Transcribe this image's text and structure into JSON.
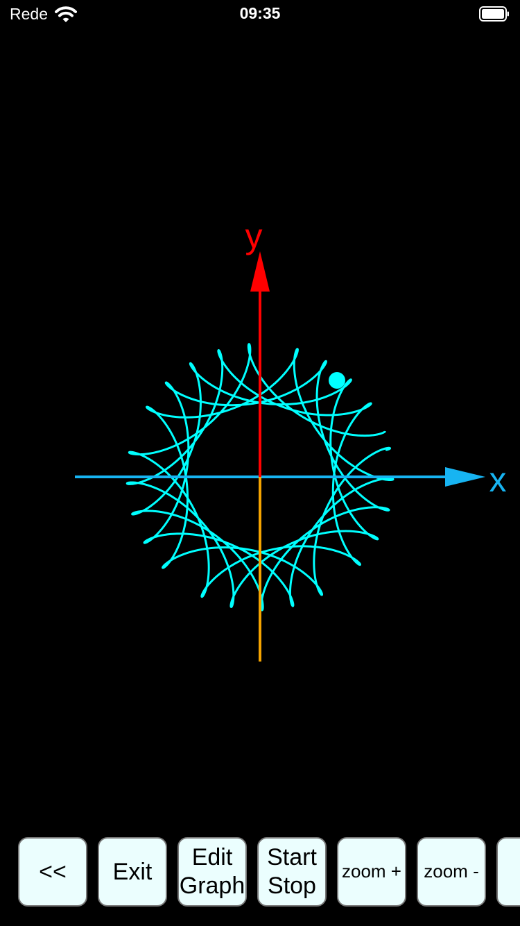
{
  "status_bar": {
    "carrier": "Rede",
    "time": "09:35"
  },
  "graph": {
    "x_axis_label": "x",
    "y_axis_label": "y",
    "colors": {
      "curve": "#00ffff",
      "x_axis": "#17b4f2",
      "y_axis_positive": "#ff0000",
      "y_axis_negative": "#f5a300",
      "background": "#000000"
    }
  },
  "toolbar": {
    "back_label": "<<",
    "exit_label": "Exit",
    "edit_graph_label": "Edit\nGraph",
    "start_stop_label": "Start\nStop",
    "zoom_in_label": "zoom +",
    "zoom_out_label": "zoom -"
  }
}
